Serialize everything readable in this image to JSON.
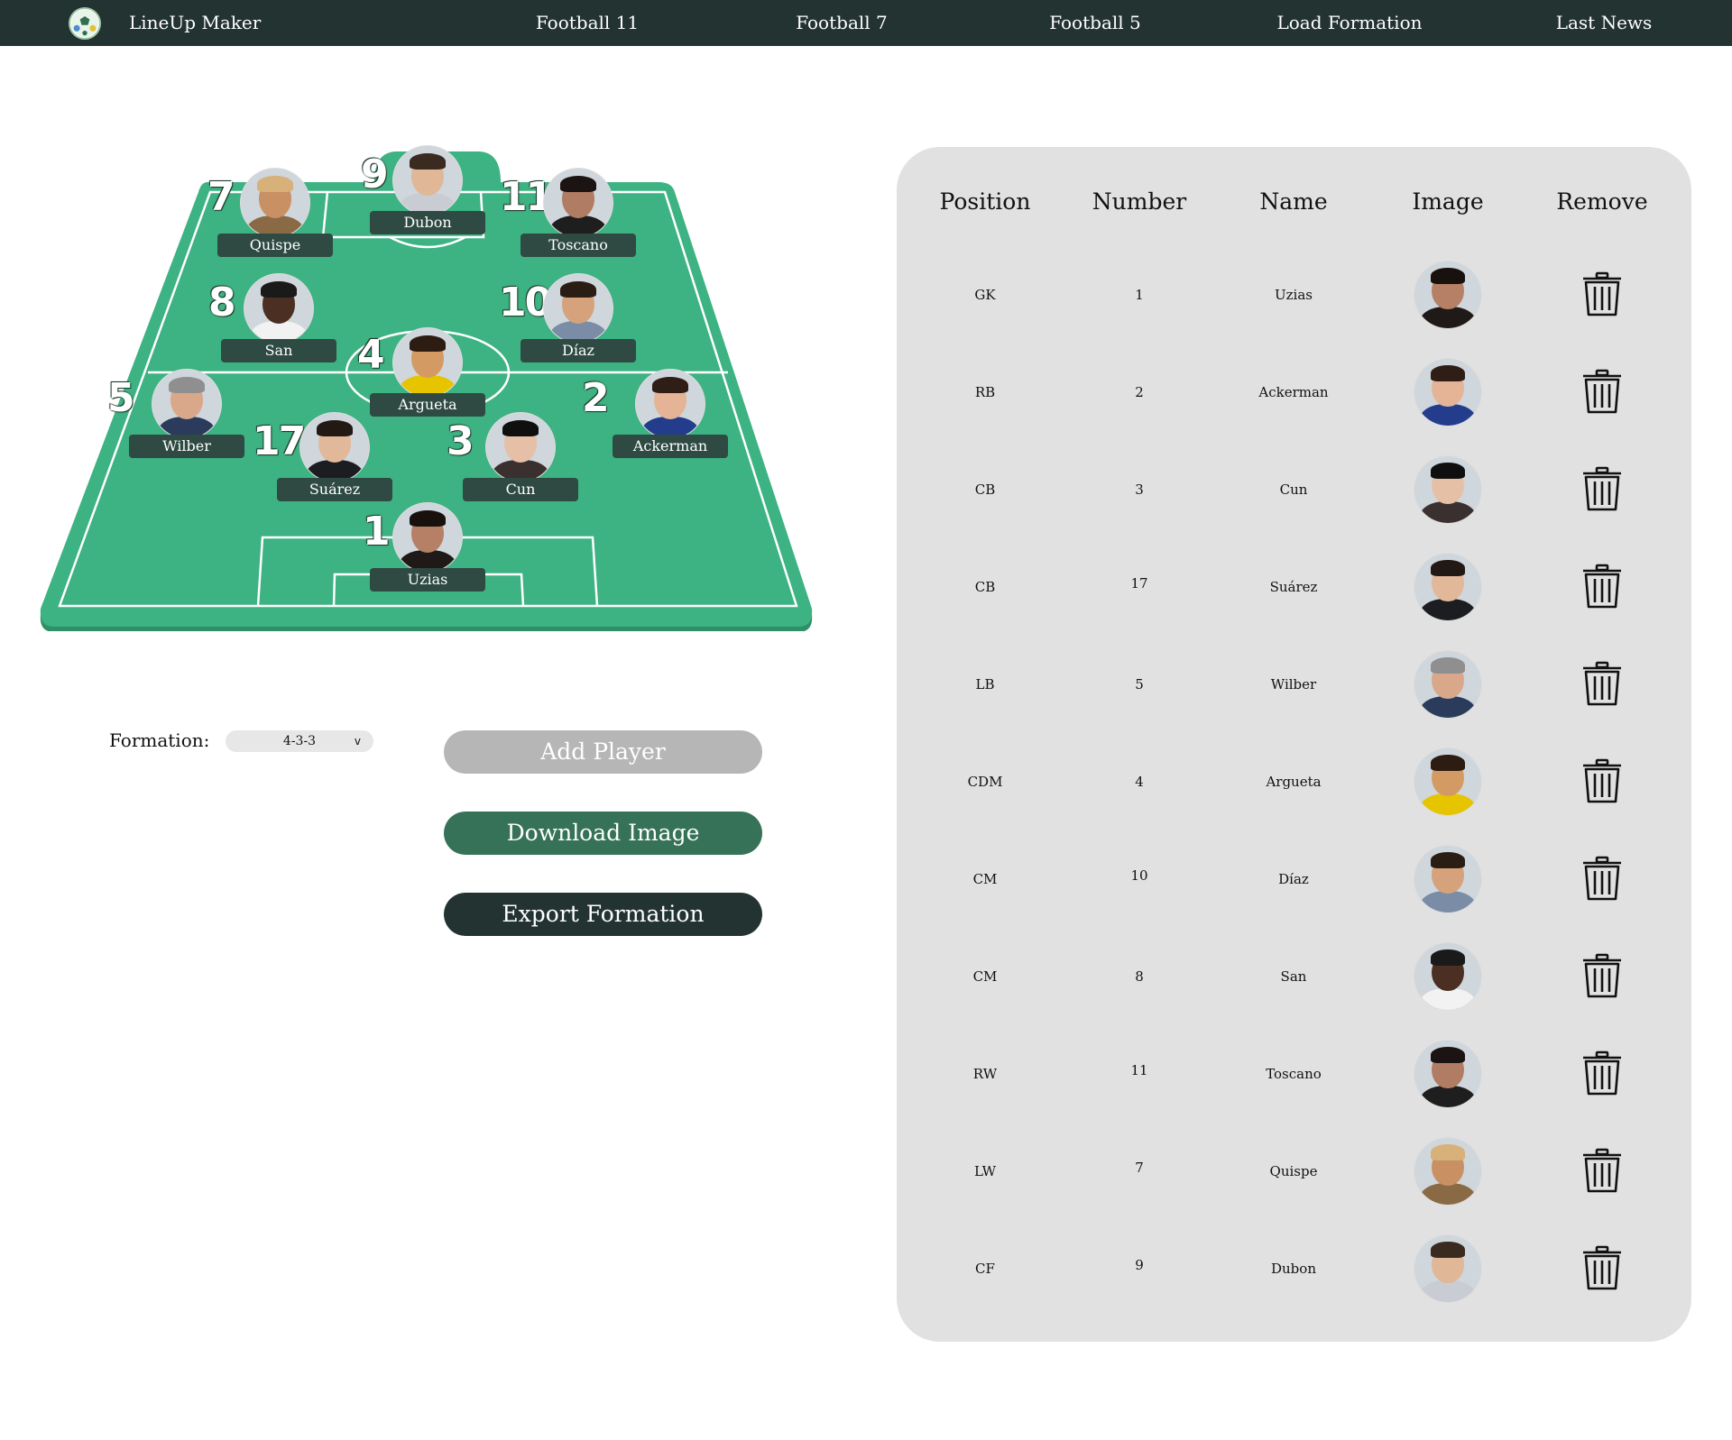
{
  "header": {
    "brand": "LineUp Maker",
    "nav": [
      "Football 11",
      "Football 7",
      "Football 5",
      "Load Formation",
      "Last News"
    ]
  },
  "pitch": {
    "players": [
      {
        "name": "Quispe",
        "number": "7",
        "skin": "#c99064",
        "hair": "#d8b07a",
        "shirt": "#8a6a44"
      },
      {
        "name": "Dubon",
        "number": "9",
        "skin": "#e0b797",
        "hair": "#3a2a20",
        "shirt": "#c9ccd3"
      },
      {
        "name": "Toscano",
        "number": "11",
        "skin": "#b07c63",
        "hair": "#1b1412",
        "shirt": "#1e1e1e"
      },
      {
        "name": "San",
        "number": "8",
        "skin": "#4a2f22",
        "hair": "#1a1a1a",
        "shirt": "#f2f2f2"
      },
      {
        "name": "Díaz",
        "number": "10",
        "skin": "#d5a27c",
        "hair": "#2a1e14",
        "shirt": "#7a8ca6"
      },
      {
        "name": "Argueta",
        "number": "4",
        "skin": "#d49a63",
        "hair": "#2c1c12",
        "shirt": "#e6c400"
      },
      {
        "name": "Wilber",
        "number": "5",
        "skin": "#d9a88a",
        "hair": "#8f8f8f",
        "shirt": "#2a3b5c"
      },
      {
        "name": "Ackerman",
        "number": "2",
        "skin": "#e5b496",
        "hair": "#2e1e16",
        "shirt": "#233c8c"
      },
      {
        "name": "Suárez",
        "number": "17",
        "skin": "#e2b89a",
        "hair": "#231914",
        "shirt": "#1c1d21"
      },
      {
        "name": "Cun",
        "number": "3",
        "skin": "#e6c0a6",
        "hair": "#0f0f0f",
        "shirt": "#3a3030"
      },
      {
        "name": "Uzias",
        "number": "1",
        "skin": "#b58066",
        "hair": "#18110e",
        "shirt": "#1f1a17"
      }
    ]
  },
  "controls": {
    "formation_label": "Formation:",
    "formation_value": "4-3-3",
    "formation_caret": "v",
    "add_player": "Add Player",
    "download_image": "Download Image",
    "export_formation": "Export Formation"
  },
  "table": {
    "headers": [
      "Position",
      "Number",
      "Name",
      "Image",
      "Remove"
    ],
    "rows": [
      {
        "position": "GK",
        "number": "1",
        "name": "Uzias",
        "skin": "#b58066",
        "hair": "#18110e",
        "shirt": "#1f1a17"
      },
      {
        "position": "RB",
        "number": "2",
        "name": "Ackerman",
        "skin": "#e5b496",
        "hair": "#2e1e16",
        "shirt": "#233c8c"
      },
      {
        "position": "CB",
        "number": "3",
        "name": "Cun",
        "skin": "#e6c0a6",
        "hair": "#0f0f0f",
        "shirt": "#3a3030"
      },
      {
        "position": "CB",
        "number": "17",
        "name": "Suárez",
        "skin": "#e2b89a",
        "hair": "#231914",
        "shirt": "#1c1d21"
      },
      {
        "position": "LB",
        "number": "5",
        "name": "Wilber",
        "skin": "#d9a88a",
        "hair": "#8f8f8f",
        "shirt": "#2a3b5c"
      },
      {
        "position": "CDM",
        "number": "4",
        "name": "Argueta",
        "skin": "#d49a63",
        "hair": "#2c1c12",
        "shirt": "#e6c400"
      },
      {
        "position": "CM",
        "number": "10",
        "name": "Díaz",
        "skin": "#d5a27c",
        "hair": "#2a1e14",
        "shirt": "#7a8ca6"
      },
      {
        "position": "CM",
        "number": "8",
        "name": "San",
        "skin": "#4a2f22",
        "hair": "#1a1a1a",
        "shirt": "#f2f2f2"
      },
      {
        "position": "RW",
        "number": "11",
        "name": "Toscano",
        "skin": "#b07c63",
        "hair": "#1b1412",
        "shirt": "#1e1e1e"
      },
      {
        "position": "LW",
        "number": "7",
        "name": "Quispe",
        "skin": "#c99064",
        "hair": "#d8b07a",
        "shirt": "#8a6a44"
      },
      {
        "position": "CF",
        "number": "9",
        "name": "Dubon",
        "skin": "#e0b797",
        "hair": "#3a2a20",
        "shirt": "#c9ccd3"
      }
    ]
  },
  "colors": {
    "topbar": "#223332",
    "pitch": "#3db282",
    "pitch_edge": "#2f8f66",
    "tag": "#2f4a43",
    "panel": "#e1e1e1",
    "download": "#367258",
    "add": "#b6b6b6"
  },
  "icons": [
    "football-logo-icon",
    "trash-icon",
    "chevron-down-icon"
  ]
}
